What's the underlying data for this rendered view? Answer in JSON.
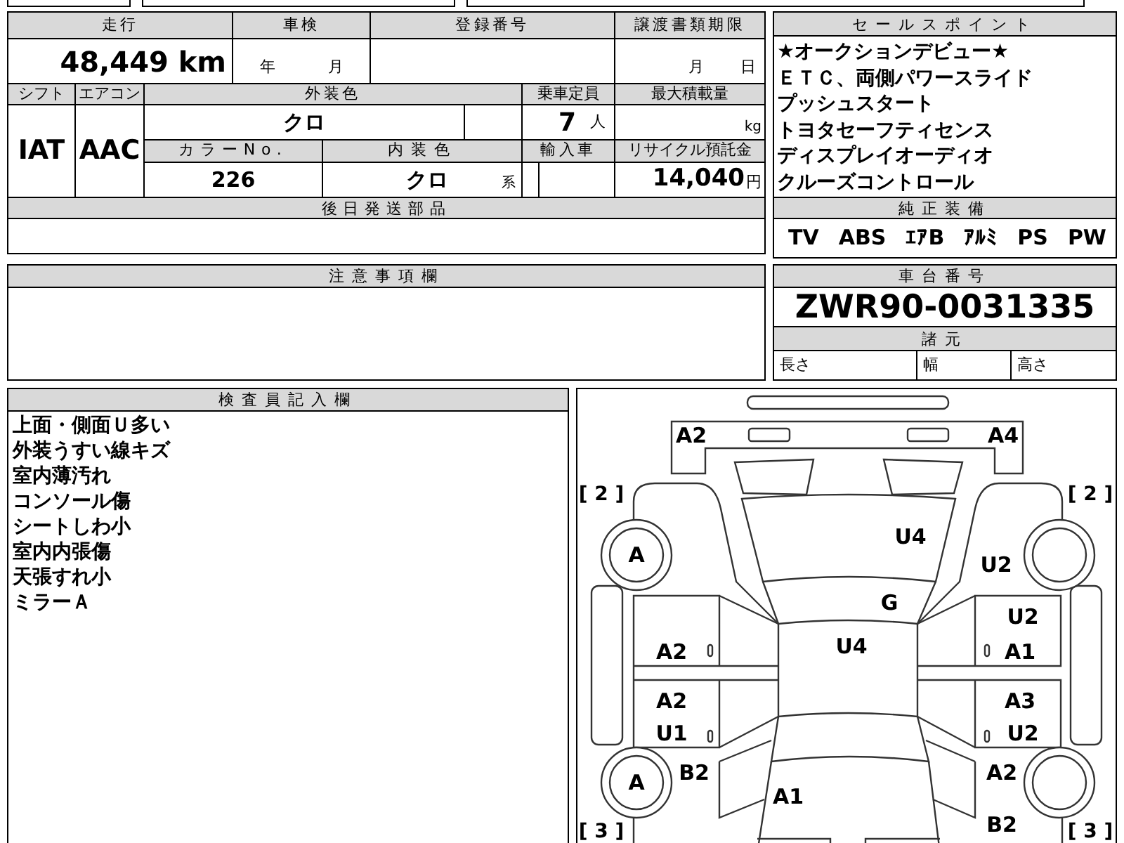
{
  "vehicle_table": {
    "headers_row1": [
      "走行",
      "車検",
      "登録番号",
      "譲渡書類期限"
    ],
    "mileage": "48,449 km",
    "inspection_units": [
      "年",
      "月"
    ],
    "transfer_units": [
      "月",
      "日"
    ],
    "headers_row2": [
      "シフト",
      "エアコン",
      "外装色",
      "乗車定員",
      "最大積載量"
    ],
    "shift": "IAT",
    "aircon": "AAC",
    "exterior_color": "クロ",
    "capacity": "7",
    "capacity_unit": "人",
    "load_unit": "kg",
    "headers_row3": [
      "カラーNo.",
      "内装色",
      "輸入車",
      "リサイクル預託金"
    ],
    "color_no": "226",
    "interior_color": "クロ",
    "interior_suffix": "系",
    "recycle_fee": "14,040",
    "recycle_unit": "円"
  },
  "parts_later": {
    "title": "後日発送部品"
  },
  "notes": {
    "title": "注意事項欄"
  },
  "sales_points": {
    "title": "セールスポイント",
    "lines": [
      "★オークションデビュー★",
      "ＥＴＣ、両側パワースライド",
      "プッシュスタート",
      "トヨタセーフティセンス",
      "ディスプレイオーディオ",
      "クルーズコントロール"
    ]
  },
  "equipment": {
    "title": "純正装備",
    "items": [
      "TV",
      "ABS",
      "ｴｱB",
      "ｱﾙﾐ",
      "PS",
      "PW"
    ]
  },
  "chassis": {
    "title": "車台番号",
    "number": "ZWR90-0031335",
    "spec_title": "諸元",
    "spec_labels": [
      "長さ",
      "幅",
      "高さ"
    ]
  },
  "inspector": {
    "title": "検査員記入欄",
    "lines": [
      "上面・側面Ｕ多い",
      "外装うすい線キズ",
      "室内薄汚れ",
      "コンソール傷",
      "シートしわ小",
      "室内内張傷",
      "天張すれ小",
      "ミラーＡ"
    ]
  },
  "diagram": {
    "marks": [
      "A2",
      "A4",
      "U4",
      "A",
      "U2",
      "G",
      "U2",
      "A2",
      "U4",
      "A1",
      "A2",
      "A3",
      "U1",
      "U2",
      "B2",
      "A2",
      "A",
      "A1",
      "B2"
    ],
    "panel_numbers": [
      "[ 2 ]",
      "[ 2 ]",
      "[ 3 ]",
      "[ 3 ]"
    ]
  }
}
